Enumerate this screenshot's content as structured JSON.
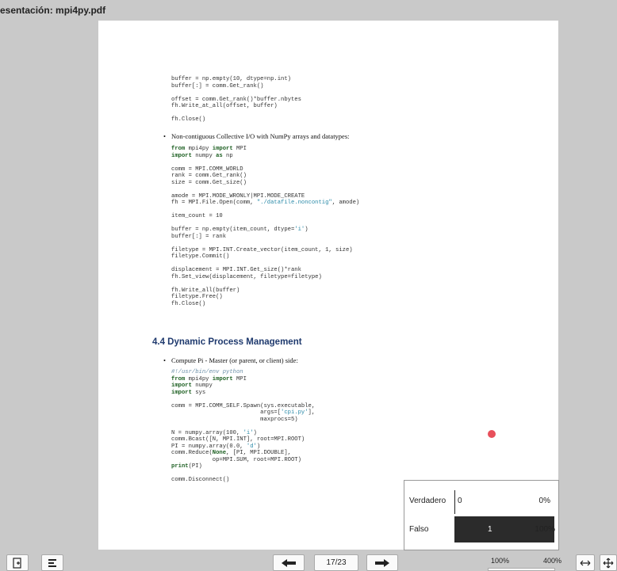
{
  "window": {
    "title": "esentación: mpi4py.pdf"
  },
  "pdf": {
    "code_block_1": [
      "buffer = np.empty(10, dtype=np.int)",
      "buffer[:] = comm.Get_rank()",
      "",
      "offset = comm.Get_rank()*buffer.nbytes",
      "fh.Write_at_all(offset, buffer)",
      "",
      "fh.Close()"
    ],
    "bullet_1": "Non-contiguous Collective I/O with NumPy arrays and datatypes:",
    "code_block_2": [
      "from mpi4py import MPI",
      "import numpy as np",
      "",
      "comm = MPI.COMM_WORLD",
      "rank = comm.Get_rank()",
      "size = comm.Get_size()",
      "",
      "amode = MPI.MODE_WRONLY|MPI.MODE_CREATE",
      "fh = MPI.File.Open(comm, \"./datafile.noncontig\", amode)",
      "",
      "item_count = 10",
      "",
      "buffer = np.empty(item_count, dtype='i')",
      "buffer[:] = rank",
      "",
      "filetype = MPI.INT.Create_vector(item_count, 1, size)",
      "filetype.Commit()",
      "",
      "displacement = MPI.INT.Get_size()*rank",
      "fh.Set_view(displacement, filetype=filetype)",
      "",
      "fh.Write_all(buffer)",
      "filetype.Free()",
      "fh.Close()"
    ],
    "section_heading": "4.4 Dynamic Process Management",
    "bullet_2": "Compute Pi - Master (or parent, or client) side:",
    "code_block_3": [
      "#!/usr/bin/env python",
      "from mpi4py import MPI",
      "import numpy",
      "import sys",
      "",
      "comm = MPI.COMM_SELF.Spawn(sys.executable,",
      "                          args=['cpi.py'],",
      "                          maxprocs=5)",
      "",
      "N = numpy.array(100, 'i')",
      "comm.Bcast([N, MPI.INT], root=MPI.ROOT)",
      "PI = numpy.array(0.0, 'd')",
      "comm.Reduce(None, [PI, MPI.DOUBLE],",
      "            op=MPI.SUM, root=MPI.ROOT)",
      "print(PI)",
      "",
      "comm.Disconnect()"
    ]
  },
  "poll": {
    "rows": [
      {
        "label": "Verdadero",
        "count": "0",
        "percent": "0%",
        "fraction": 0.0
      },
      {
        "label": "Falso",
        "count": "1",
        "percent": "100%",
        "fraction": 1.0
      }
    ]
  },
  "toolbar": {
    "page_indicator": "17/23",
    "zoom_min": "100%",
    "zoom_max": "400%",
    "zoom_level": 0.0
  },
  "icons": {
    "left": [
      "file-add-icon",
      "list-icon"
    ],
    "nav": [
      "arrow-left-icon",
      "arrow-right-icon"
    ],
    "right": [
      "fit-width-icon",
      "move-icon"
    ]
  },
  "colors": {
    "heading": "#1f3a6e",
    "pointer": "#e8505b",
    "bar": "#2b2b2b"
  }
}
